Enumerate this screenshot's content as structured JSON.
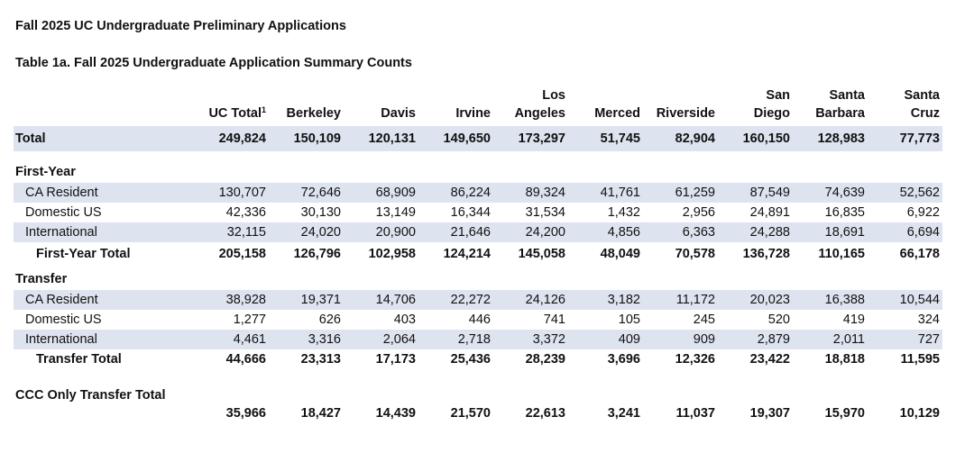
{
  "title": "Fall 2025 UC Undergraduate Preliminary Applications",
  "subtitle": "Table 1a. Fall 2025 Undergraduate Application Summary Counts",
  "columns": [
    {
      "line1": "",
      "line2": "UC Total",
      "sup": "1"
    },
    {
      "line1": "",
      "line2": "Berkeley"
    },
    {
      "line1": "",
      "line2": "Davis"
    },
    {
      "line1": "",
      "line2": "Irvine"
    },
    {
      "line1": "Los",
      "line2": "Angeles"
    },
    {
      "line1": "",
      "line2": "Merced"
    },
    {
      "line1": "",
      "line2": "Riverside"
    },
    {
      "line1": "San",
      "line2": "Diego"
    },
    {
      "line1": "Santa",
      "line2": "Barbara"
    },
    {
      "line1": "Santa",
      "line2": "Cruz"
    }
  ],
  "total": {
    "label": "Total",
    "values": [
      "249,824",
      "150,109",
      "120,131",
      "149,650",
      "173,297",
      "51,745",
      "82,904",
      "160,150",
      "128,983",
      "77,773"
    ]
  },
  "first_year": {
    "heading": "First-Year",
    "rows": [
      {
        "label": "CA Resident",
        "values": [
          "130,707",
          "72,646",
          "68,909",
          "86,224",
          "89,324",
          "41,761",
          "61,259",
          "87,549",
          "74,639",
          "52,562"
        ]
      },
      {
        "label": "Domestic US",
        "values": [
          "42,336",
          "30,130",
          "13,149",
          "16,344",
          "31,534",
          "1,432",
          "2,956",
          "24,891",
          "16,835",
          "6,922"
        ]
      },
      {
        "label": "International",
        "values": [
          "32,115",
          "24,020",
          "20,900",
          "21,646",
          "24,200",
          "4,856",
          "6,363",
          "24,288",
          "18,691",
          "6,694"
        ]
      }
    ],
    "total": {
      "label": "First-Year Total",
      "values": [
        "205,158",
        "126,796",
        "102,958",
        "124,214",
        "145,058",
        "48,049",
        "70,578",
        "136,728",
        "110,165",
        "66,178"
      ]
    }
  },
  "transfer": {
    "heading": "Transfer",
    "rows": [
      {
        "label": "CA Resident",
        "values": [
          "38,928",
          "19,371",
          "14,706",
          "22,272",
          "24,126",
          "3,182",
          "11,172",
          "20,023",
          "16,388",
          "10,544"
        ]
      },
      {
        "label": "Domestic US",
        "values": [
          "1,277",
          "626",
          "403",
          "446",
          "741",
          "105",
          "245",
          "520",
          "419",
          "324"
        ]
      },
      {
        "label": "International",
        "values": [
          "4,461",
          "3,316",
          "2,064",
          "2,718",
          "3,372",
          "409",
          "909",
          "2,879",
          "2,011",
          "727"
        ]
      }
    ],
    "total": {
      "label": "Transfer Total",
      "values": [
        "44,666",
        "23,313",
        "17,173",
        "25,436",
        "28,239",
        "3,696",
        "12,326",
        "23,422",
        "18,818",
        "11,595"
      ]
    }
  },
  "ccc": {
    "label": "CCC Only Transfer Total",
    "values": [
      "35,966",
      "18,427",
      "14,439",
      "21,570",
      "22,613",
      "3,241",
      "11,037",
      "19,307",
      "15,970",
      "10,129"
    ]
  }
}
